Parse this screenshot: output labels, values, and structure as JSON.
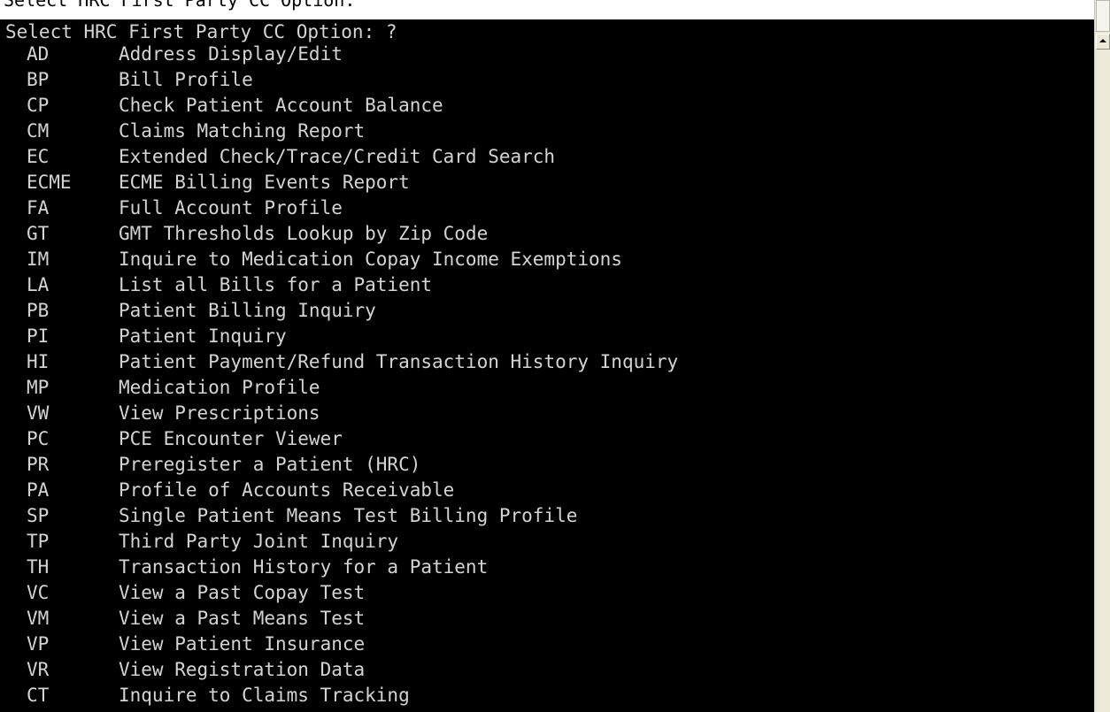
{
  "window": {
    "top_text": "Select HRC First Party CC Option:"
  },
  "terminal": {
    "prompt": "Select HRC First Party CC Option: ?",
    "options": [
      {
        "code": "AD",
        "label": "Address Display/Edit"
      },
      {
        "code": "BP",
        "label": "Bill Profile"
      },
      {
        "code": "CP",
        "label": "Check Patient Account Balance"
      },
      {
        "code": "CM",
        "label": "Claims Matching Report"
      },
      {
        "code": "EC",
        "label": "Extended Check/Trace/Credit Card Search"
      },
      {
        "code": "ECME",
        "label": "ECME Billing Events Report"
      },
      {
        "code": "FA",
        "label": "Full Account Profile"
      },
      {
        "code": "GT",
        "label": "GMT Thresholds Lookup by Zip Code"
      },
      {
        "code": "IM",
        "label": "Inquire to Medication Copay Income Exemptions"
      },
      {
        "code": "LA",
        "label": "List all Bills for a Patient"
      },
      {
        "code": "PB",
        "label": "Patient Billing Inquiry"
      },
      {
        "code": "PI",
        "label": "Patient Inquiry"
      },
      {
        "code": "HI",
        "label": "Patient Payment/Refund Transaction History Inquiry"
      },
      {
        "code": "MP",
        "label": "Medication Profile"
      },
      {
        "code": "VW",
        "label": "View Prescriptions"
      },
      {
        "code": "PC",
        "label": "PCE Encounter Viewer"
      },
      {
        "code": "PR",
        "label": "Preregister a Patient (HRC)"
      },
      {
        "code": "PA",
        "label": "Profile of Accounts Receivable"
      },
      {
        "code": "SP",
        "label": "Single Patient Means Test Billing Profile"
      },
      {
        "code": "TP",
        "label": "Third Party Joint Inquiry"
      },
      {
        "code": "TH",
        "label": "Transaction History for a Patient"
      },
      {
        "code": "VC",
        "label": "View a Past Copay Test"
      },
      {
        "code": "VM",
        "label": "View a Past Means Test"
      },
      {
        "code": "VP",
        "label": "View Patient Insurance"
      },
      {
        "code": "VR",
        "label": "View Registration Data"
      },
      {
        "code": "CT",
        "label": "Inquire to Claims Tracking"
      }
    ]
  },
  "scrollbar": {
    "up_icon": "scroll-up-arrow"
  },
  "colors": {
    "terminal_bg": "#000000",
    "terminal_text": "#d4d4d4",
    "scrollbar_bg": "#ece9d8"
  }
}
